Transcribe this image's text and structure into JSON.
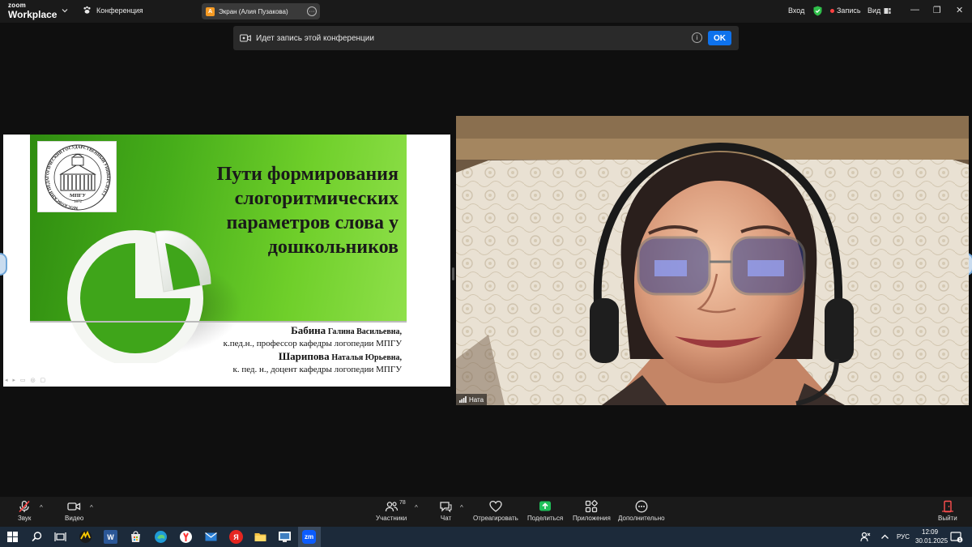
{
  "app": {
    "logo_line1": "zoom",
    "logo_line2": "Workplace",
    "meeting_label": "Конференция"
  },
  "share_tab": {
    "avatar_letter": "А",
    "label": "Экран (Алия Пузакова)",
    "more_glyph": "···"
  },
  "topright": {
    "enter_label": "Вход",
    "record_label": "Запись",
    "view_label": "Вид",
    "minimize": "—",
    "restore": "❐",
    "close": "✕"
  },
  "banner": {
    "text": "Идет запись этой конференции",
    "info_glyph": "i",
    "ok_label": "OK"
  },
  "slide": {
    "title_lines": [
      "Пути формирования",
      "слогоритмических",
      "параметров слова у",
      "дошкольников"
    ],
    "emblem_ring_text": "МОСКОВСКИЙ ПЕДАГОГИЧЕСКИЙ ГОСУДАРСТВЕННЫЙ УНИВЕРСИТЕТ",
    "emblem_abbr": "МПГУ",
    "emblem_year": "1872",
    "author1_surname": "Бабина",
    "author1_name": "Галина Васильевна,",
    "author1_role": "к.пед.н., профессор кафедры логопедии МПГУ",
    "author2_surname": "Шарипова",
    "author2_name": "Наталья Юрьевна,",
    "author2_role": "к. пед. н., доцент кафедры логопедии МПГУ"
  },
  "video": {
    "participant_name": "Ната"
  },
  "toolbar": {
    "audio_label": "Звук",
    "video_label": "Видео",
    "participants_label": "Участники",
    "participants_count": "78",
    "chat_label": "Чат",
    "react_label": "Отреагировать",
    "share_label": "Поделиться",
    "apps_label": "Приложения",
    "more_label": "Дополнительно",
    "leave_label": "Выйти",
    "caret": "^"
  },
  "taskbar": {
    "lang": "РУС",
    "time": "12:09",
    "date": "30.01.2025",
    "notif_count": "1",
    "apps": [
      "windows-start",
      "search",
      "task-view",
      "yandex-music",
      "word",
      "store",
      "edge",
      "yandex-browser",
      "mail",
      "yandex",
      "explorer",
      "remote-desktop",
      "zoom"
    ],
    "zoom_glyph": "zm",
    "word_glyph": "W",
    "yandex_glyph": "Я"
  },
  "colors": {
    "accent_blue": "#0e72ed",
    "slide_green": "#46ad1a",
    "record_red": "#ff4040",
    "shield_green": "#2fbf4a",
    "share_green": "#1fc05a"
  }
}
